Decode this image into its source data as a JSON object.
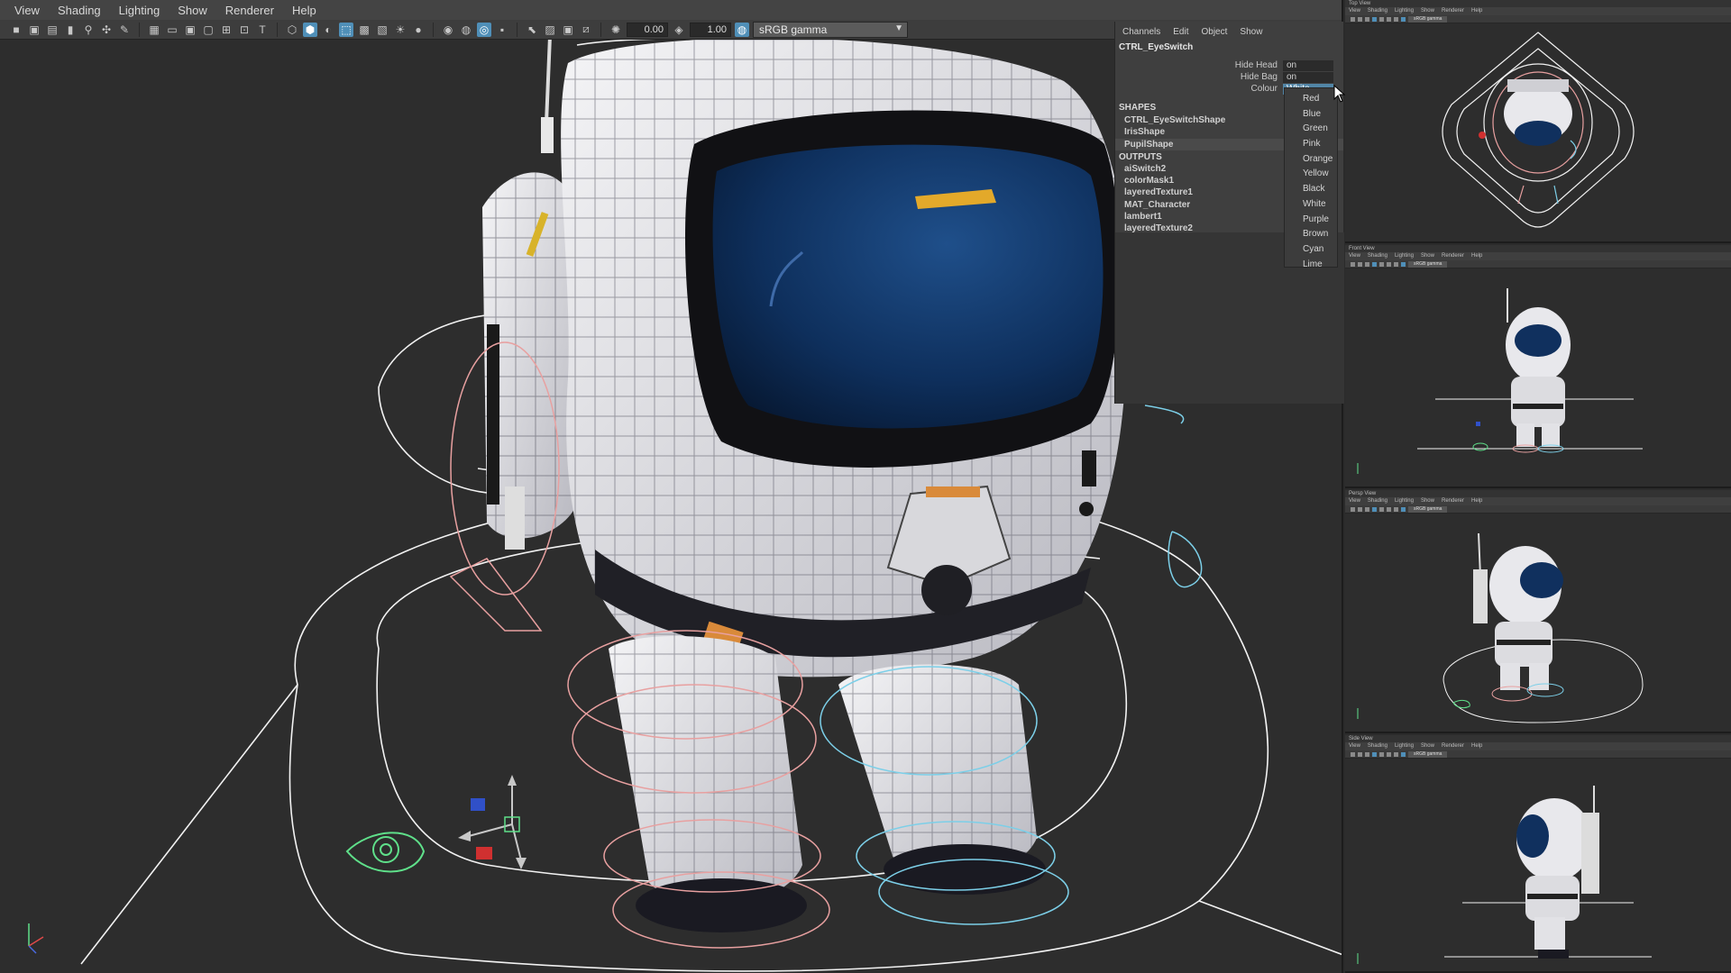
{
  "menubar": {
    "items": [
      "View",
      "Shading",
      "Lighting",
      "Show",
      "Renderer",
      "Help"
    ]
  },
  "toolbar": {
    "exposure": "0.00",
    "gamma": "1.00",
    "color_space": "sRGB gamma"
  },
  "channel_box": {
    "menus": [
      "Channels",
      "Edit",
      "Object",
      "Show"
    ],
    "node_name": "CTRL_EyeSwitch",
    "attributes": [
      {
        "name": "Hide Head",
        "value": "on"
      },
      {
        "name": "Hide Bag",
        "value": "on"
      },
      {
        "name": "Colour",
        "value": "White"
      }
    ],
    "shapes_header": "SHAPES",
    "shapes": [
      "CTRL_EyeSwitchShape",
      "IrisShape",
      "PupilShape"
    ],
    "outputs_header": "OUTPUTS",
    "outputs": [
      "aiSwitch2",
      "colorMask1",
      "layeredTexture1",
      "MAT_Character",
      "lambert1",
      "layeredTexture2"
    ]
  },
  "colour_dropdown": {
    "options": [
      "Red",
      "Blue",
      "Green",
      "Pink",
      "Orange",
      "Yellow",
      "Black",
      "White",
      "Purple",
      "Brown",
      "Cyan",
      "Lime"
    ]
  },
  "side_panels": [
    {
      "title": "Top View",
      "gamma": "sRGB gamma"
    },
    {
      "title": "Front View",
      "gamma": "sRGB gamma"
    },
    {
      "title": "Persp View",
      "gamma": "sRGB gamma"
    },
    {
      "title": "Side View",
      "gamma": "sRGB gamma"
    }
  ],
  "side_panel_menu": [
    "View",
    "Shading",
    "Lighting",
    "Show",
    "Renderer",
    "Help"
  ],
  "colors": {
    "viewport_bg": "#2d2d2d",
    "selection_blue": "#5285a6",
    "control_white": "#f2f2f2",
    "control_pink": "#e8a0a0",
    "control_cyan": "#7ccfe8",
    "control_green": "#5fe08a"
  }
}
